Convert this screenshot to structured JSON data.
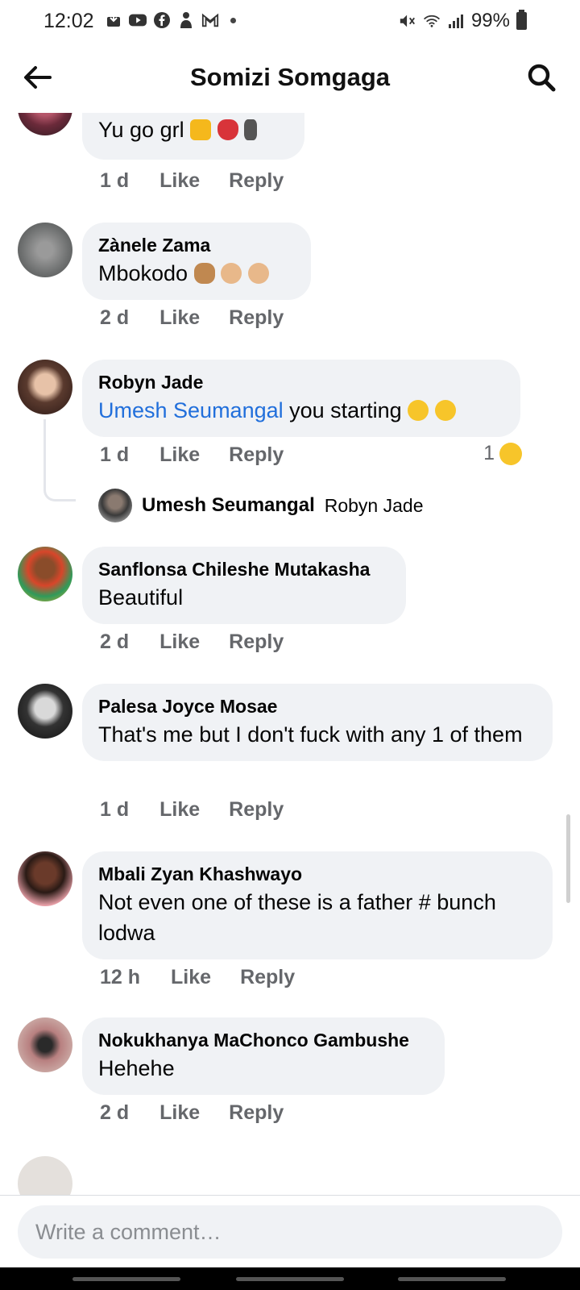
{
  "status_bar": {
    "time": "12:02",
    "battery": "99%",
    "icons": [
      "download-icon",
      "youtube-icon",
      "facebook-icon",
      "teams-icon",
      "gmail-icon",
      "dot-icon"
    ],
    "right_icons": [
      "mute-icon",
      "wifi-icon",
      "signal-icon",
      "battery-icon"
    ]
  },
  "header": {
    "title": "Somizi Somgaga"
  },
  "actions": {
    "like": "Like",
    "reply": "Reply"
  },
  "comments": [
    {
      "author": "",
      "text": "Yu go grl",
      "emojis": [
        "thumbs-up-emoji",
        "dancer-emoji",
        "man-dancing-emoji"
      ],
      "time": "1 d"
    },
    {
      "author": "Zànele Zama",
      "text": "Mbokodo",
      "emojis": [
        "raised-hands-emoji",
        "clapping-emoji",
        "clapping-emoji"
      ],
      "time": "2 d"
    },
    {
      "author": "Robyn Jade",
      "mention": "Umesh Seumangal",
      "text": " you starting",
      "emojis": [
        "rofl-emoji",
        "rofl-emoji"
      ],
      "time": "1 d",
      "reaction_count": "1",
      "reaction_emoji": "laughing-emoji",
      "reply_preview": {
        "author": "Umesh Seumangal",
        "text": "Robyn Jade"
      }
    },
    {
      "author": "Sanflonsa Chileshe Mutakasha",
      "text": "Beautiful",
      "time": "2 d"
    },
    {
      "author": "Palesa Joyce Mosae",
      "text": "That's me but I don't fuck with any 1 of them",
      "time": "1 d"
    },
    {
      "author": "Mbali Zyan Khashwayo",
      "text": "Not even one of these is a father # bunch lodwa",
      "time": "12 h"
    },
    {
      "author": "Nokukhanya MaChonco Gambushe",
      "text": "Hehehe",
      "time": "2 d"
    }
  ],
  "composer": {
    "placeholder": "Write a comment…"
  },
  "colors": {
    "bubble": "#f0f2f5",
    "mention": "#216fdb",
    "meta_text": "#65676b"
  }
}
